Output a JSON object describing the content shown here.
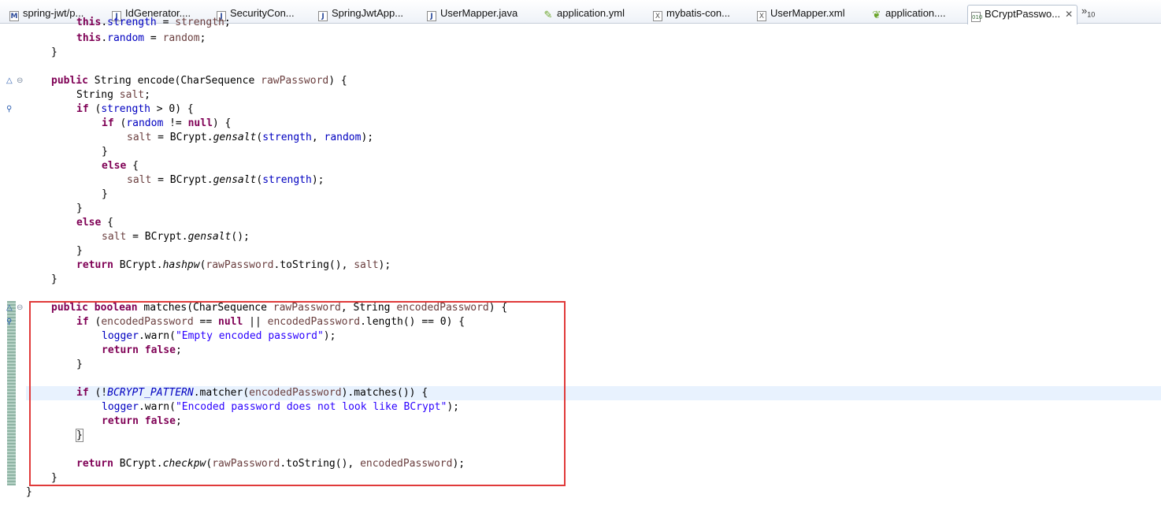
{
  "tabs": [
    {
      "label": "spring-jwt/p...",
      "icon": "maven-pom-icon"
    },
    {
      "label": "IdGenerator....",
      "icon": "java-file-icon"
    },
    {
      "label": "SecurityCon...",
      "icon": "java-file-icon"
    },
    {
      "label": "SpringJwtApp...",
      "icon": "java-file-icon"
    },
    {
      "label": "UserMapper.java",
      "icon": "java-file-icon"
    },
    {
      "label": "application.yml",
      "icon": "spring-yml-icon"
    },
    {
      "label": "mybatis-con...",
      "icon": "xml-file-icon"
    },
    {
      "label": "UserMapper.xml",
      "icon": "xml-file-icon"
    },
    {
      "label": "application....",
      "icon": "spring-leaf-icon"
    },
    {
      "label": "BCryptPasswo...",
      "icon": "class-file-icon",
      "active": true
    }
  ],
  "tab_overflow": {
    "symbol": "»",
    "count": "10"
  },
  "code": {
    "l0": {
      "a": "this",
      "b": ".",
      "c": "strength",
      "d": " = ",
      "e": "strength",
      "f": ";"
    },
    "l1": {
      "a": "this",
      "b": ".",
      "c": "random",
      "d": " = ",
      "e": "random",
      "f": ";"
    },
    "l2": {
      "a": "}"
    },
    "l4": {
      "a": "public",
      "b": " String encode(CharSequence ",
      "c": "rawPassword",
      "d": ") {"
    },
    "l5": {
      "a": "String ",
      "b": "salt",
      "c": ";"
    },
    "l6": {
      "a": "if",
      "b": " (",
      "c": "strength",
      "d": " > 0) {"
    },
    "l7": {
      "a": "if",
      "b": " (",
      "c": "random",
      "d": " != ",
      "e": "null",
      "f": ") {"
    },
    "l8": {
      "a": "salt",
      "b": " = BCrypt.",
      "c": "gensalt",
      "d": "(",
      "e": "strength",
      "f": ", ",
      "g": "random",
      "h": ");"
    },
    "l9": {
      "a": "}"
    },
    "l10": {
      "a": "else",
      "b": " {"
    },
    "l11": {
      "a": "salt",
      "b": " = BCrypt.",
      "c": "gensalt",
      "d": "(",
      "e": "strength",
      "f": ");"
    },
    "l12": {
      "a": "}"
    },
    "l13": {
      "a": "}"
    },
    "l14": {
      "a": "else",
      "b": " {"
    },
    "l15": {
      "a": "salt",
      "b": " = BCrypt.",
      "c": "gensalt",
      "d": "();"
    },
    "l16": {
      "a": "}"
    },
    "l17": {
      "a": "return",
      "b": " BCrypt.",
      "c": "hashpw",
      "d": "(",
      "e": "rawPassword",
      "f": ".toString(), ",
      "g": "salt",
      "h": ");"
    },
    "l18": {
      "a": "}"
    },
    "l20": {
      "a": "public",
      "b": " ",
      "c": "boolean",
      "d": " matches(CharSequence ",
      "e": "rawPassword",
      "f": ", String ",
      "g": "encodedPassword",
      "h": ") {"
    },
    "l21": {
      "a": "if",
      "b": " (",
      "c": "encodedPassword",
      "d": " == ",
      "e": "null",
      "f": " || ",
      "g": "encodedPassword",
      "h": ".length() == 0) {"
    },
    "l22": {
      "a": "logger",
      "b": ".warn(",
      "c": "\"Empty encoded password\"",
      "d": ");"
    },
    "l23": {
      "a": "return",
      "b": " ",
      "c": "false",
      "d": ";"
    },
    "l24": {
      "a": "}"
    },
    "l26": {
      "a": "if",
      "b": " (!",
      "c": "BCRYPT_PATTERN",
      "d": ".matcher(",
      "e": "encodedPassword",
      "f": ").matches()) {"
    },
    "l27": {
      "a": "logger",
      "b": ".warn(",
      "c": "\"Encoded password does not look like BCrypt\"",
      "d": ");"
    },
    "l28": {
      "a": "return",
      "b": " ",
      "c": "false",
      "d": ";"
    },
    "l29": {
      "a": "}"
    },
    "l31": {
      "a": "return",
      "b": " BCrypt.",
      "c": "checkpw",
      "d": "(",
      "e": "rawPassword",
      "f": ".toString(), ",
      "g": "encodedPassword",
      "h": ");"
    },
    "l32": {
      "a": "}"
    },
    "l33": {
      "a": "}"
    }
  },
  "colors": {
    "keyword": "#7f0055",
    "field": "#0000c0",
    "local": "#6a3e3e",
    "string": "#2a00ff",
    "highlight_box": "#e03a3a",
    "current_line": "#e8f2fe"
  }
}
